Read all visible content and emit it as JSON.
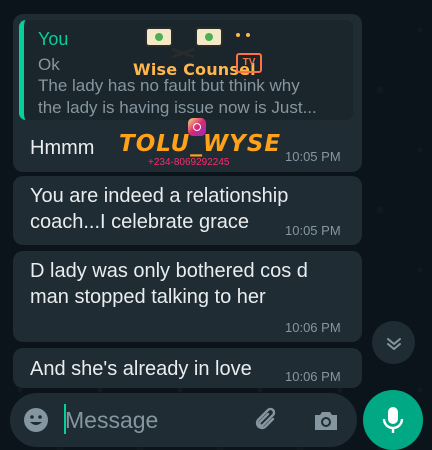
{
  "messages": [
    {
      "quote": {
        "author": "You",
        "lines": [
          "Ok",
          "The lady has no fault but think why",
          "the lady is having issue now is Just..."
        ]
      },
      "text": "Hmmm",
      "time": "10:05 PM"
    },
    {
      "text_lines": [
        "You are indeed a relationship",
        "coach...I celebrate grace"
      ],
      "time": "10:05 PM"
    },
    {
      "text_lines": [
        "D lady was only bothered cos d",
        "man stopped talking to her"
      ],
      "time": "10:06 PM"
    },
    {
      "text": "And she's already in love",
      "time": "10:06 PM"
    }
  ],
  "watermark": {
    "title": "Wise Counsel",
    "badge": "TV",
    "handle": "TOLU_WYSE",
    "phone": "+234-8069292245"
  },
  "input": {
    "placeholder": "Message"
  },
  "colors": {
    "background": "#0b141a",
    "bubble": "#1f2c34",
    "accent": "#06cf9c",
    "mic": "#00a884"
  },
  "icons": [
    "emoji-icon",
    "attach-icon",
    "camera-icon",
    "mic-icon",
    "chevron-down-icon"
  ]
}
